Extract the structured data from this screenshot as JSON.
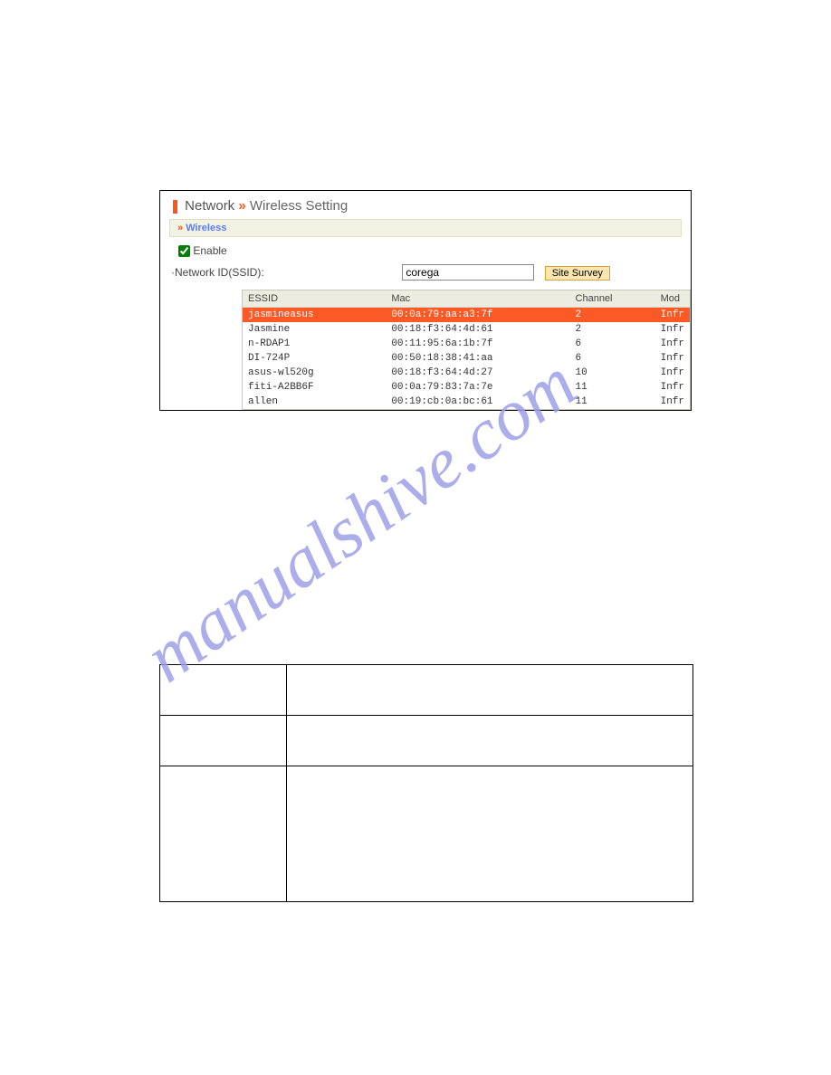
{
  "screenshot": {
    "title_network": "Network",
    "title_arrows": "»",
    "title_wireless_setting": "Wireless Setting",
    "subheader_arrows": "»",
    "subheader_wireless": "Wireless",
    "enable_label": "Enable",
    "enable_checked": true,
    "ssid_label": "·Network ID(SSID):",
    "ssid_value": "corega",
    "site_survey_btn": "Site Survey",
    "columns": {
      "essid": "ESSID",
      "mac": "Mac",
      "channel": "Channel",
      "mode": "Mod"
    },
    "rows": [
      {
        "essid": "jasmineasus",
        "mac": "00:0a:79:aa:a3:7f",
        "channel": "2",
        "mode": "Infr",
        "selected": true
      },
      {
        "essid": "Jasmine",
        "mac": "00:18:f3:64:4d:61",
        "channel": "2",
        "mode": "Infr",
        "selected": false
      },
      {
        "essid": "n-RDAP1",
        "mac": "00:11:95:6a:1b:7f",
        "channel": "6",
        "mode": "Infr",
        "selected": false
      },
      {
        "essid": "DI-724P",
        "mac": "00:50:18:38:41:aa",
        "channel": "6",
        "mode": "Infr",
        "selected": false
      },
      {
        "essid": "asus-wl520g",
        "mac": "00:18:f3:64:4d:27",
        "channel": "10",
        "mode": "Infr",
        "selected": false
      },
      {
        "essid": "fiti-A2BB6F",
        "mac": "00:0a:79:83:7a:7e",
        "channel": "11",
        "mode": "Infr",
        "selected": false
      },
      {
        "essid": "allen",
        "mac": "00:19:cb:0a:bc:61",
        "channel": "11",
        "mode": "Infr",
        "selected": false
      }
    ]
  },
  "watermark_text": "manualshive.com",
  "chart_data": {
    "type": "table",
    "title": "Wireless Site Survey results",
    "columns": [
      "ESSID",
      "Mac",
      "Channel",
      "Mode"
    ],
    "rows": [
      [
        "jasmineasus",
        "00:0a:79:aa:a3:7f",
        2,
        "Infrastructure"
      ],
      [
        "Jasmine",
        "00:18:f3:64:4d:61",
        2,
        "Infrastructure"
      ],
      [
        "n-RDAP1",
        "00:11:95:6a:1b:7f",
        6,
        "Infrastructure"
      ],
      [
        "DI-724P",
        "00:50:18:38:41:aa",
        6,
        "Infrastructure"
      ],
      [
        "asus-wl520g",
        "00:18:f3:64:4d:27",
        10,
        "Infrastructure"
      ],
      [
        "fiti-A2BB6F",
        "00:0a:79:83:7a:7e",
        11,
        "Infrastructure"
      ],
      [
        "allen",
        "00:19:cb:0a:bc:61",
        11,
        "Infrastructure"
      ]
    ]
  }
}
